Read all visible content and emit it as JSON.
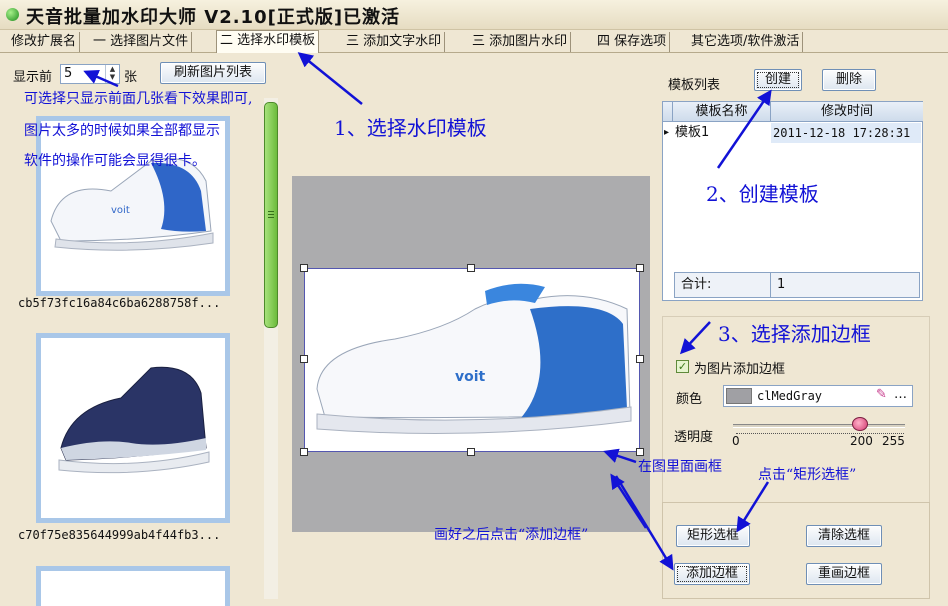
{
  "window": {
    "title": "天音批量加水印大师 V2.10[正式版]已激活"
  },
  "tabs": [
    {
      "label": "修改扩展名"
    },
    {
      "label": "一 选择图片文件"
    },
    {
      "label": "二 选择水印模板"
    },
    {
      "label": "三 添加文字水印"
    },
    {
      "label": "三 添加图片水印"
    },
    {
      "label": "四 保存选项"
    },
    {
      "label": "其它选项/软件激活"
    }
  ],
  "left_panel": {
    "show_first_label": "显示前",
    "show_first_value": "5",
    "unit_label": "张",
    "refresh_button": "刷新图片列表",
    "thumbnails": [
      {
        "name": "cb5f73fc16a84c6ba6288758f..."
      },
      {
        "name": "c70f75e835644999ab4f44fb3..."
      }
    ]
  },
  "right_panel": {
    "template_list_label": "模板列表",
    "create_button": "创建",
    "delete_button": "删除",
    "grid": {
      "columns": [
        "模板名称",
        "修改时间"
      ],
      "rows": [
        {
          "name": "模板1",
          "time": "2011-12-18 17:28:31"
        }
      ]
    },
    "total_label": "合计:",
    "total_value": "1",
    "add_border_checkbox": "为图片添加边框",
    "color_label": "颜色",
    "color_value": "clMedGray",
    "opacity_label": "透明度",
    "slider": {
      "min": "0",
      "value": "200",
      "max": "255"
    },
    "rect_select_button": "矩形选框",
    "clear_select_button": "清除选框",
    "add_border_button": "添加边框",
    "redraw_border_button": "重画边框"
  },
  "annotations": {
    "tip_line1": "可选择只显示前面几张看下效果即可,",
    "tip_line2": "图片太多的时候如果全部都显示",
    "tip_line3": "软件的操作可能会显得很卡。",
    "step1": "1、选择水印模板",
    "step2": "2、创建模板",
    "step3": "3、选择添加边框",
    "draw_in_image": "在图里面画框",
    "click_rect": "点击“矩形选框”",
    "after_draw": "画好之后点击“添加边框”"
  },
  "colors": {
    "annotation_blue": "#1212d6",
    "thumbnail_border": "#a9c7e8",
    "canvas_gray": "#acacae",
    "scroll_green": "#6cbb3c"
  }
}
